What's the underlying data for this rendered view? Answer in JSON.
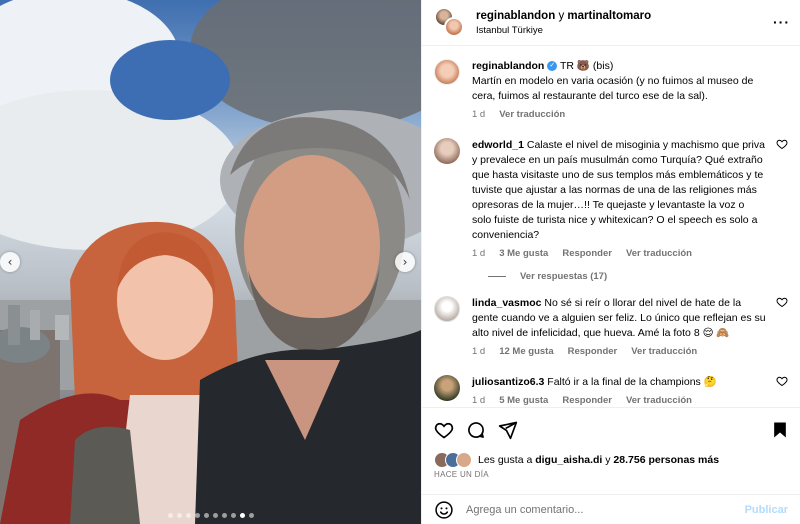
{
  "header": {
    "user1": "reginablandon",
    "conj": "y",
    "user2": "martinaltomaro",
    "location": "Istanbul Türkiye"
  },
  "caption": {
    "username": "reginablandon",
    "badge_text": "TR 🐻 (bis)",
    "text": "Martín en modelo en varia ocasión (y no fuimos al museo de cera, fuimos al restaurante del turco ese de la sal).",
    "time": "1 d",
    "translate": "Ver traducción"
  },
  "comments": [
    {
      "username": "edworld_1",
      "text": "Calaste el nivel de misoginia y machismo que priva y prevalece en un país musulmán como Turquía? Qué extraño que hasta visitaste uno de sus templos más emblemáticos y te tuviste que ajustar a las normas de una de las religiones más opresoras de la mujer…!! Te quejaste y levantaste la voz o solo fuiste de turista nice y whitexican? O el speech es solo a conveniencia?",
      "time": "1 d",
      "likes": "3 Me gusta",
      "reply": "Responder",
      "translate": "Ver traducción",
      "view_replies": "Ver respuestas (17)",
      "avatar_color": "#c9a48e"
    },
    {
      "username": "linda_vasmoc",
      "text": "No sé si reír o llorar del nivel de hate de la gente cuando ve a alguien ser feliz. Lo único que reflejan es su alto nivel de infelicidad, que hueva. Amé la foto 8 😌 🙈",
      "time": "1 d",
      "likes": "12 Me gusta",
      "reply": "Responder",
      "translate": "Ver traducción",
      "avatar_color": "#e6dcd6"
    },
    {
      "username": "juliosantizo6.3",
      "text": "Faltó ir a la final de la champions 🤔",
      "time": "1 d",
      "likes": "5 Me gusta",
      "reply": "Responder",
      "translate": "Ver traducción",
      "avatar_color": "#3d4a2c"
    }
  ],
  "likes": {
    "prefix": "Les gusta a",
    "user": "digu_aisha.di",
    "mid": "y",
    "others": "28.756 personas más"
  },
  "time_ago": "HACE UN DÍA",
  "add_comment": {
    "placeholder": "Agrega un comentario...",
    "post": "Publicar"
  },
  "carousel": {
    "total": 10,
    "active_index": 8
  },
  "colors": {
    "accent": "#0095f6",
    "post_disabled": "#b3dbff",
    "meta": "#737373"
  }
}
